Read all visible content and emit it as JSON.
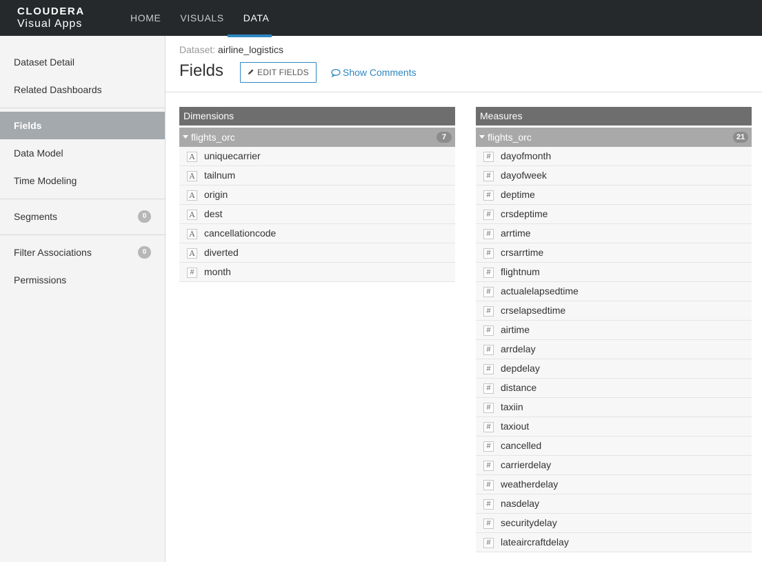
{
  "brand": {
    "name": "CLOUDERA",
    "product": "Visual Apps"
  },
  "nav": {
    "items": [
      {
        "label": "HOME",
        "active": false
      },
      {
        "label": "VISUALS",
        "active": false
      },
      {
        "label": "DATA",
        "active": true
      }
    ],
    "accent": "#2e86c1"
  },
  "sidebar": {
    "items": [
      {
        "label": "Dataset Detail"
      },
      {
        "label": "Related Dashboards"
      },
      {
        "label": "Fields",
        "active": true
      },
      {
        "label": "Data Model"
      },
      {
        "label": "Time Modeling"
      },
      {
        "label": "Segments",
        "badge": "0"
      },
      {
        "label": "Filter Associations",
        "badge": "0"
      },
      {
        "label": "Permissions"
      }
    ]
  },
  "header": {
    "dataset_label": "Dataset:",
    "dataset_name": "airline_logistics",
    "title": "Fields",
    "edit_button": "EDIT FIELDS",
    "show_comments": "Show Comments"
  },
  "dimensions": {
    "title": "Dimensions",
    "group": "flights_orc",
    "count": "7",
    "fields": [
      {
        "name": "uniquecarrier",
        "type": "A"
      },
      {
        "name": "tailnum",
        "type": "A"
      },
      {
        "name": "origin",
        "type": "A"
      },
      {
        "name": "dest",
        "type": "A"
      },
      {
        "name": "cancellationcode",
        "type": "A"
      },
      {
        "name": "diverted",
        "type": "A"
      },
      {
        "name": "month",
        "type": "#"
      }
    ]
  },
  "measures": {
    "title": "Measures",
    "group": "flights_orc",
    "count": "21",
    "fields": [
      {
        "name": "dayofmonth",
        "type": "#"
      },
      {
        "name": "dayofweek",
        "type": "#"
      },
      {
        "name": "deptime",
        "type": "#"
      },
      {
        "name": "crsdeptime",
        "type": "#"
      },
      {
        "name": "arrtime",
        "type": "#"
      },
      {
        "name": "crsarrtime",
        "type": "#"
      },
      {
        "name": "flightnum",
        "type": "#"
      },
      {
        "name": "actualelapsedtime",
        "type": "#"
      },
      {
        "name": "crselapsedtime",
        "type": "#"
      },
      {
        "name": "airtime",
        "type": "#"
      },
      {
        "name": "arrdelay",
        "type": "#"
      },
      {
        "name": "depdelay",
        "type": "#"
      },
      {
        "name": "distance",
        "type": "#"
      },
      {
        "name": "taxiin",
        "type": "#"
      },
      {
        "name": "taxiout",
        "type": "#"
      },
      {
        "name": "cancelled",
        "type": "#"
      },
      {
        "name": "carrierdelay",
        "type": "#"
      },
      {
        "name": "weatherdelay",
        "type": "#"
      },
      {
        "name": "nasdelay",
        "type": "#"
      },
      {
        "name": "securitydelay",
        "type": "#"
      },
      {
        "name": "lateaircraftdelay",
        "type": "#"
      }
    ]
  }
}
